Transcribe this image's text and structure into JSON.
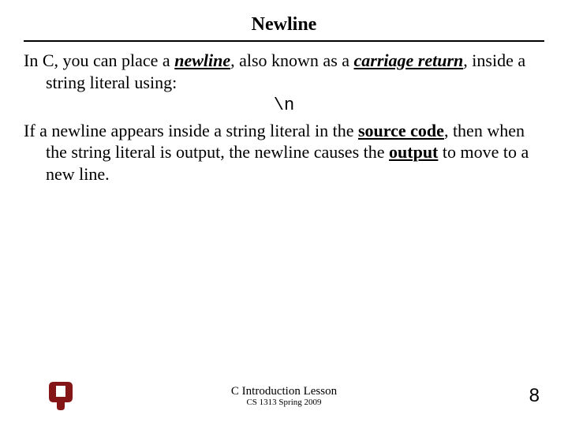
{
  "title": "Newline",
  "p1_a": "In C, you can place a ",
  "p1_newline": "newline",
  "p1_b": ", also known as a ",
  "p1_carriage": "carriage return",
  "p1_c": ", inside a string literal using:",
  "code": "\\n",
  "p2_a": "If a newline appears inside a string literal in the ",
  "p2_source": "source code",
  "p2_b": ", then when the string literal is output, the newline causes the ",
  "p2_output": "output",
  "p2_c": " to move to a new line.",
  "footer_title": "C Introduction Lesson",
  "footer_sub": "CS 1313 Spring 2009",
  "page_number": "8",
  "logo_color": "#841617"
}
